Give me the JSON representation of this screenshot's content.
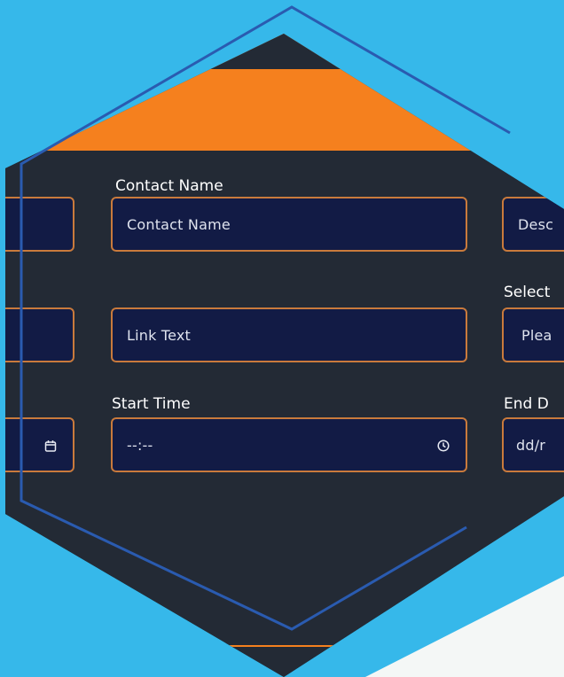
{
  "form": {
    "contact_name_label": "Contact Name",
    "contact_name_placeholder": "Contact Name",
    "link_text_placeholder": "Link Text",
    "start_time_label": "Start Time",
    "start_time_value": "--:--",
    "right_col_top_placeholder": "Desc",
    "right_col_select_label": "Select",
    "right_col_select_value": "Plea",
    "right_col_end_label": "End D",
    "right_col_end_value": "dd/r"
  },
  "colors": {
    "background": "#36b8ea",
    "panel": "#232a35",
    "accent": "#f5801e",
    "field_fill": "#121b45",
    "field_border": "#c97a3c",
    "outline": "#2a5bb0"
  },
  "icons": {
    "left_date_field": "calendar-icon",
    "start_time_field": "clock-icon"
  }
}
